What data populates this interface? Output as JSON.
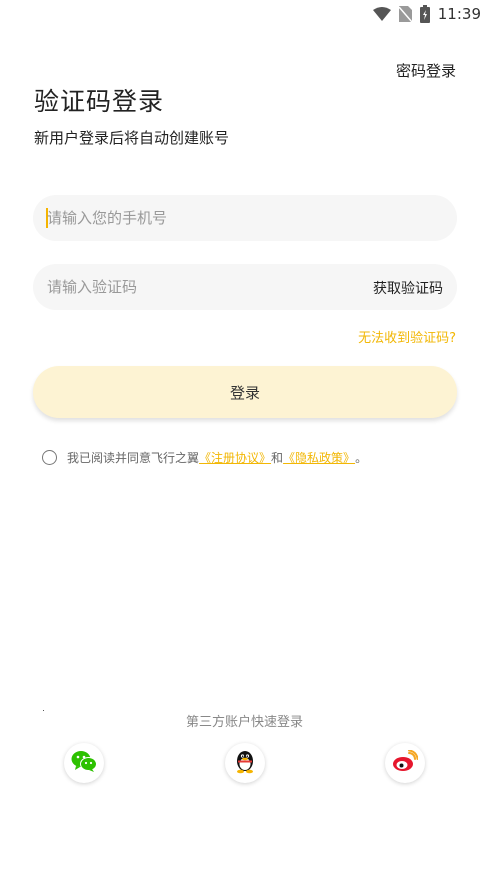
{
  "status_bar": {
    "time": "11:39",
    "icons": [
      "wifi-icon",
      "no-sim-icon",
      "battery-charging-icon"
    ]
  },
  "header": {
    "password_login": "密码登录",
    "title": "验证码登录",
    "subtitle": "新用户登录后将自动创建账号"
  },
  "form": {
    "phone_placeholder": "请输入您的手机号",
    "code_placeholder": "请输入验证码",
    "get_code": "获取验证码",
    "no_code": "无法收到验证码?",
    "login_button": "登录"
  },
  "agreement": {
    "prefix": "我已阅读并同意飞行之翼",
    "terms_link": "《注册协议》",
    "connector": "和",
    "privacy_link": "《隐私政策》",
    "suffix": "。",
    "checked": false
  },
  "third_party": {
    "title": "第三方账户快速登录",
    "providers": [
      "wechat-icon",
      "qq-icon",
      "weibo-icon"
    ]
  },
  "colors": {
    "accent": "#f2b705",
    "button_bg": "#fdf3d3",
    "field_bg": "#f6f6f6"
  }
}
